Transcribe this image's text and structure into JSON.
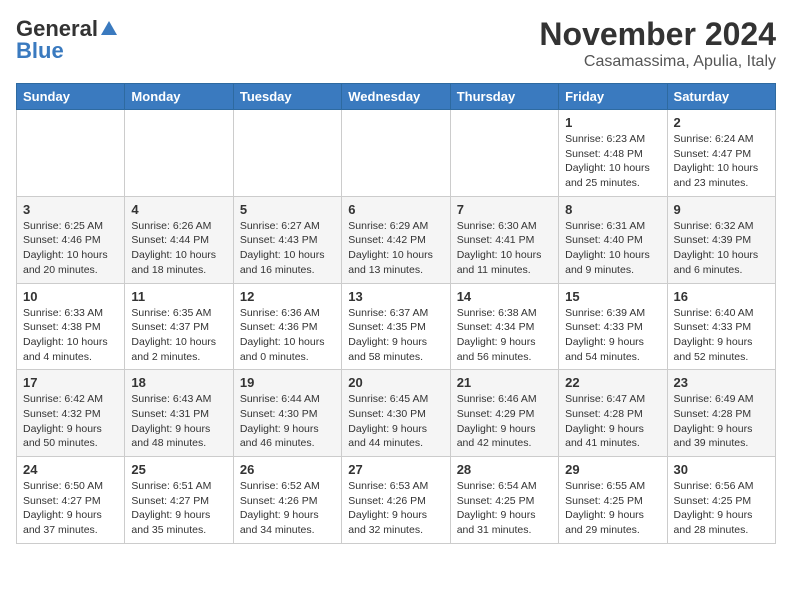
{
  "header": {
    "logo_general": "General",
    "logo_blue": "Blue",
    "title": "November 2024",
    "subtitle": "Casamassima, Apulia, Italy"
  },
  "weekdays": [
    "Sunday",
    "Monday",
    "Tuesday",
    "Wednesday",
    "Thursday",
    "Friday",
    "Saturday"
  ],
  "weeks": [
    [
      {
        "day": "",
        "info": ""
      },
      {
        "day": "",
        "info": ""
      },
      {
        "day": "",
        "info": ""
      },
      {
        "day": "",
        "info": ""
      },
      {
        "day": "",
        "info": ""
      },
      {
        "day": "1",
        "info": "Sunrise: 6:23 AM\nSunset: 4:48 PM\nDaylight: 10 hours and 25 minutes."
      },
      {
        "day": "2",
        "info": "Sunrise: 6:24 AM\nSunset: 4:47 PM\nDaylight: 10 hours and 23 minutes."
      }
    ],
    [
      {
        "day": "3",
        "info": "Sunrise: 6:25 AM\nSunset: 4:46 PM\nDaylight: 10 hours and 20 minutes."
      },
      {
        "day": "4",
        "info": "Sunrise: 6:26 AM\nSunset: 4:44 PM\nDaylight: 10 hours and 18 minutes."
      },
      {
        "day": "5",
        "info": "Sunrise: 6:27 AM\nSunset: 4:43 PM\nDaylight: 10 hours and 16 minutes."
      },
      {
        "day": "6",
        "info": "Sunrise: 6:29 AM\nSunset: 4:42 PM\nDaylight: 10 hours and 13 minutes."
      },
      {
        "day": "7",
        "info": "Sunrise: 6:30 AM\nSunset: 4:41 PM\nDaylight: 10 hours and 11 minutes."
      },
      {
        "day": "8",
        "info": "Sunrise: 6:31 AM\nSunset: 4:40 PM\nDaylight: 10 hours and 9 minutes."
      },
      {
        "day": "9",
        "info": "Sunrise: 6:32 AM\nSunset: 4:39 PM\nDaylight: 10 hours and 6 minutes."
      }
    ],
    [
      {
        "day": "10",
        "info": "Sunrise: 6:33 AM\nSunset: 4:38 PM\nDaylight: 10 hours and 4 minutes."
      },
      {
        "day": "11",
        "info": "Sunrise: 6:35 AM\nSunset: 4:37 PM\nDaylight: 10 hours and 2 minutes."
      },
      {
        "day": "12",
        "info": "Sunrise: 6:36 AM\nSunset: 4:36 PM\nDaylight: 10 hours and 0 minutes."
      },
      {
        "day": "13",
        "info": "Sunrise: 6:37 AM\nSunset: 4:35 PM\nDaylight: 9 hours and 58 minutes."
      },
      {
        "day": "14",
        "info": "Sunrise: 6:38 AM\nSunset: 4:34 PM\nDaylight: 9 hours and 56 minutes."
      },
      {
        "day": "15",
        "info": "Sunrise: 6:39 AM\nSunset: 4:33 PM\nDaylight: 9 hours and 54 minutes."
      },
      {
        "day": "16",
        "info": "Sunrise: 6:40 AM\nSunset: 4:33 PM\nDaylight: 9 hours and 52 minutes."
      }
    ],
    [
      {
        "day": "17",
        "info": "Sunrise: 6:42 AM\nSunset: 4:32 PM\nDaylight: 9 hours and 50 minutes."
      },
      {
        "day": "18",
        "info": "Sunrise: 6:43 AM\nSunset: 4:31 PM\nDaylight: 9 hours and 48 minutes."
      },
      {
        "day": "19",
        "info": "Sunrise: 6:44 AM\nSunset: 4:30 PM\nDaylight: 9 hours and 46 minutes."
      },
      {
        "day": "20",
        "info": "Sunrise: 6:45 AM\nSunset: 4:30 PM\nDaylight: 9 hours and 44 minutes."
      },
      {
        "day": "21",
        "info": "Sunrise: 6:46 AM\nSunset: 4:29 PM\nDaylight: 9 hours and 42 minutes."
      },
      {
        "day": "22",
        "info": "Sunrise: 6:47 AM\nSunset: 4:28 PM\nDaylight: 9 hours and 41 minutes."
      },
      {
        "day": "23",
        "info": "Sunrise: 6:49 AM\nSunset: 4:28 PM\nDaylight: 9 hours and 39 minutes."
      }
    ],
    [
      {
        "day": "24",
        "info": "Sunrise: 6:50 AM\nSunset: 4:27 PM\nDaylight: 9 hours and 37 minutes."
      },
      {
        "day": "25",
        "info": "Sunrise: 6:51 AM\nSunset: 4:27 PM\nDaylight: 9 hours and 35 minutes."
      },
      {
        "day": "26",
        "info": "Sunrise: 6:52 AM\nSunset: 4:26 PM\nDaylight: 9 hours and 34 minutes."
      },
      {
        "day": "27",
        "info": "Sunrise: 6:53 AM\nSunset: 4:26 PM\nDaylight: 9 hours and 32 minutes."
      },
      {
        "day": "28",
        "info": "Sunrise: 6:54 AM\nSunset: 4:25 PM\nDaylight: 9 hours and 31 minutes."
      },
      {
        "day": "29",
        "info": "Sunrise: 6:55 AM\nSunset: 4:25 PM\nDaylight: 9 hours and 29 minutes."
      },
      {
        "day": "30",
        "info": "Sunrise: 6:56 AM\nSunset: 4:25 PM\nDaylight: 9 hours and 28 minutes."
      }
    ]
  ]
}
